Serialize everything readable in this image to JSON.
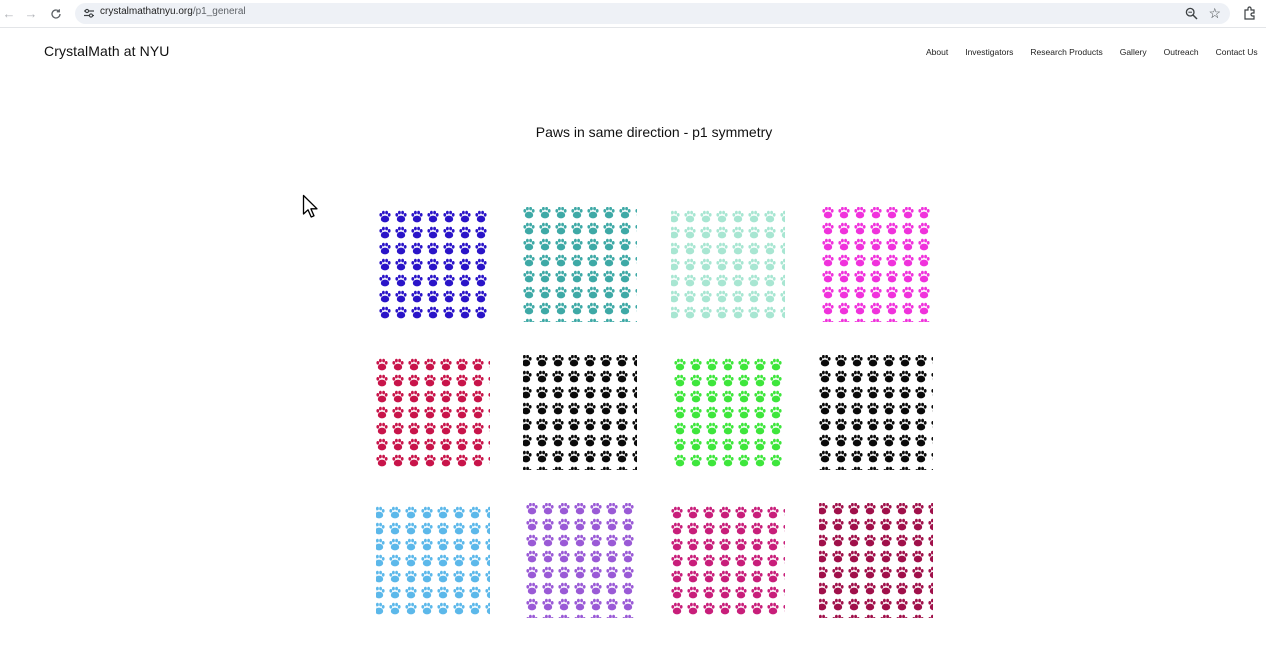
{
  "browser": {
    "url_domain": "crystalmathatnyu.org",
    "url_path": "/p1_general"
  },
  "site": {
    "title": "CrystalMath at NYU",
    "nav": [
      "About",
      "Investigators",
      "Research Products",
      "Gallery",
      "Outreach",
      "Contact Us"
    ]
  },
  "page": {
    "heading": "Paws in same direction - p1 symmetry"
  },
  "gallery": {
    "tiles": [
      {
        "color": "#2a14c8"
      },
      {
        "color": "#3ea9a6"
      },
      {
        "color": "#a8e6d2"
      },
      {
        "color": "#f032dc"
      },
      {
        "color": "#c8144a"
      },
      {
        "color": "#0a0a0a"
      },
      {
        "color": "#3ee63c"
      },
      {
        "color": "#0a0a0a"
      },
      {
        "color": "#5cb8ea"
      },
      {
        "color": "#9a5ad6"
      },
      {
        "color": "#c81e7a"
      },
      {
        "color": "#a0104a"
      }
    ]
  }
}
